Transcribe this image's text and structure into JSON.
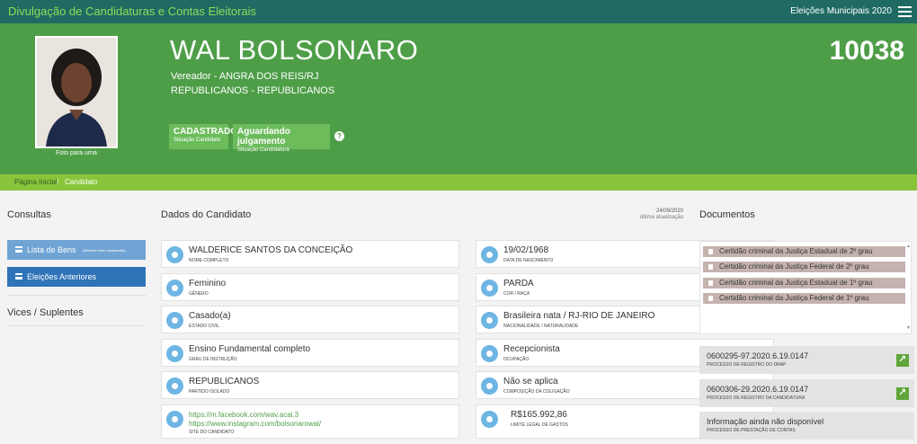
{
  "topbar": {
    "title": "Divulgação de Candidaturas e Contas Eleitorais",
    "election": "Eleições Municipais 2020",
    "menu_icon": "hamburger-menu-icon"
  },
  "candidate": {
    "name": "WAL BOLSONARO",
    "role": "Vereador - ANGRA DOS REIS/RJ",
    "party": "REPUBLICANOS - REPUBLICANOS",
    "number": "10038",
    "photo_caption": "Foto para urna",
    "status": {
      "value": "CADASTRADO",
      "label": "Situação Candidato"
    },
    "application": {
      "value": "Aguardando julgamento",
      "label": "Situação Candidatura"
    }
  },
  "breadcrumb": {
    "home": "Página Inicial",
    "separator": "/",
    "current": "Candidato"
  },
  "consultas": {
    "title": "Consultas",
    "bens_label": "Lista de Bens",
    "bens_note": "(Nenhum bem cadastrado)",
    "anteriores_label": "Eleições Anteriores"
  },
  "vices": {
    "title": "Vices / Suplentes"
  },
  "dados": {
    "title": "Dados do Candidato",
    "updated_date": "24/09/2020",
    "updated_label": "última atualização",
    "left": [
      {
        "value": "WALDERICE SANTOS DA CONCEIÇÃO",
        "label": "Nome completo",
        "icon": "person-icon"
      },
      {
        "value": "Feminino",
        "label": "Gênero",
        "icon": "gender-icon"
      },
      {
        "value": "Casado(a)",
        "label": "Estado civil",
        "icon": "ring-icon"
      },
      {
        "value": "Ensino Fundamental completo",
        "label": "Grau de instrução",
        "icon": "graduation-cap-icon"
      },
      {
        "value": "REPUBLICANOS",
        "label": "Partido isolado",
        "icon": "group-icon"
      }
    ],
    "right": [
      {
        "value": "19/02/1968",
        "label": "Data de nascimento",
        "icon": "calendar-icon"
      },
      {
        "value": "PARDA",
        "label": "Cor / raça",
        "icon": "person-silhouette-icon"
      },
      {
        "value": "Brasileira nata / RJ-RIO DE JANEIRO",
        "label": "Nacionalidade / naturalidade",
        "icon": "map-icon"
      },
      {
        "value": "Recepcionista",
        "label": "Ocupação",
        "icon": "briefcase-icon"
      },
      {
        "value": "Não se aplica",
        "label": "Composição da coligação",
        "icon": "folder-icon"
      }
    ],
    "site": {
      "links": [
        "https://m.facebook.com/wav.acai.3",
        "https://www.instagram.com/bolsonarowal/"
      ],
      "label": "Site do candidato",
      "icon": "globe-icon"
    },
    "gastos": {
      "value": "R$165.992,86",
      "label": "Limite legal de gastos",
      "icon": "dollar-icon"
    }
  },
  "documentos": {
    "title": "Documentos",
    "items": [
      "Certidão criminal da Justiça Estadual de 2º grau",
      "Certidão criminal da Justiça Federal de 2º grau",
      "Certidão criminal da Justiça Estadual de 1º grau",
      "Certidão criminal da Justiça Federal de 1º grau"
    ],
    "processos": [
      {
        "number": "0600295-97.2020.6.19.0147",
        "label": "Processo de registro do DRAP"
      },
      {
        "number": "0600306-29.2020.6.19.0147",
        "label": "Processo de registro da candidatura"
      },
      {
        "number": "Informação ainda não disponível",
        "label": "Processo de prestação de contas"
      }
    ]
  },
  "colors": {
    "topbar": "#1f6b63",
    "hero": "#4e9e48",
    "breadcrumb": "#89c53b",
    "button_light": "#6fa4d4",
    "button_dark": "#2f73b8",
    "icon": "#6db5e3",
    "document": "#c4b2ae"
  }
}
